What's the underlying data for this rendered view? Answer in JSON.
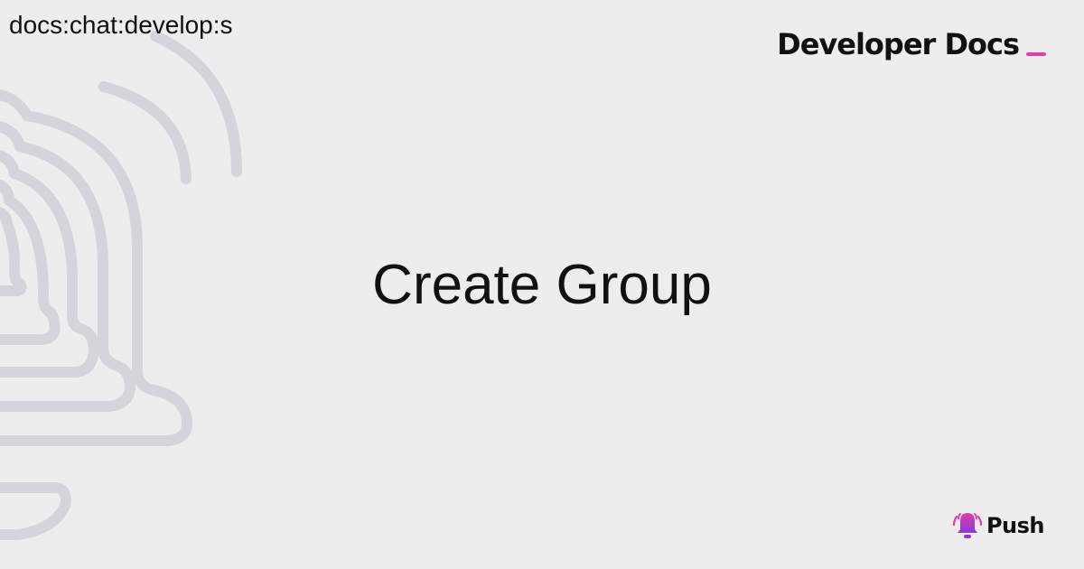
{
  "header": {
    "slug": "docs:chat:develop:s",
    "brand_title": "Developer Docs"
  },
  "main": {
    "title": "Create Group"
  },
  "footer": {
    "logo_text": "Push"
  },
  "icons": {
    "decor": "bell-line-art",
    "logo": "bell-icon"
  },
  "colors": {
    "background": "#ededee",
    "text": "#111111",
    "decor_stroke": "#d5d4da",
    "accent_pink": "#e03ea8",
    "accent_purple": "#8b3ad9"
  }
}
